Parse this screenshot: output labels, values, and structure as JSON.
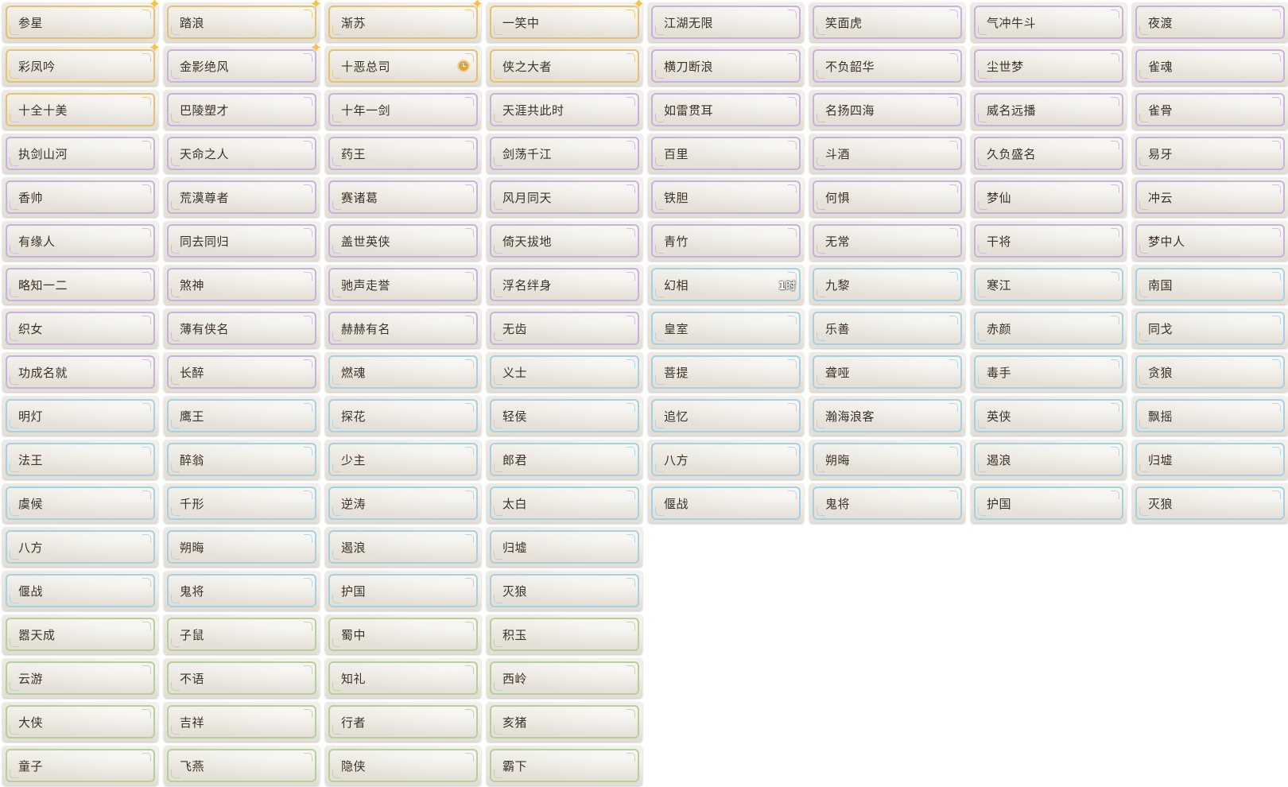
{
  "palette": {
    "gold": "#e2c27a",
    "purple": "#c7b2dd",
    "blue": "#a9cfe0",
    "green": "#b7cf9c"
  },
  "grid": {
    "columns": 8,
    "tiles": [
      {
        "label": "参星",
        "tier": "gold",
        "badge": "sparkle-icon"
      },
      {
        "label": "踏浪",
        "tier": "gold",
        "badge": "sparkle-icon"
      },
      {
        "label": "渐苏",
        "tier": "gold",
        "badge": "sparkle-icon"
      },
      {
        "label": "一笑中",
        "tier": "gold",
        "badge": "sparkle-icon"
      },
      {
        "label": "江湖无限",
        "tier": "purple"
      },
      {
        "label": "笑面虎",
        "tier": "purple"
      },
      {
        "label": "气冲牛斗",
        "tier": "purple"
      },
      {
        "label": "夜渡",
        "tier": "purple"
      },
      {
        "label": "彩凤吟",
        "tier": "gold",
        "badge": "sparkle-icon"
      },
      {
        "label": "金影绝风",
        "tier": "purple",
        "badge": "sparkle-icon"
      },
      {
        "label": "十恶总司",
        "tier": "gold",
        "badge": "clock-icon"
      },
      {
        "label": "侠之大者",
        "tier": "gold"
      },
      {
        "label": "横刀断浪",
        "tier": "purple"
      },
      {
        "label": "不负韶华",
        "tier": "purple"
      },
      {
        "label": "尘世梦",
        "tier": "purple"
      },
      {
        "label": "雀魂",
        "tier": "purple"
      },
      {
        "label": "十全十美",
        "tier": "gold"
      },
      {
        "label": "巴陵塑才",
        "tier": "purple"
      },
      {
        "label": "十年一剑",
        "tier": "purple"
      },
      {
        "label": "天涯共此时",
        "tier": "purple"
      },
      {
        "label": "如雷贯耳",
        "tier": "purple"
      },
      {
        "label": "名扬四海",
        "tier": "purple"
      },
      {
        "label": "威名远播",
        "tier": "purple"
      },
      {
        "label": "雀骨",
        "tier": "purple"
      },
      {
        "label": "执剑山河",
        "tier": "purple"
      },
      {
        "label": "天命之人",
        "tier": "purple"
      },
      {
        "label": "药王",
        "tier": "purple"
      },
      {
        "label": "剑荡千江",
        "tier": "purple"
      },
      {
        "label": "百里",
        "tier": "purple"
      },
      {
        "label": "斗酒",
        "tier": "purple"
      },
      {
        "label": "久负盛名",
        "tier": "purple"
      },
      {
        "label": "易牙",
        "tier": "purple"
      },
      {
        "label": "香帅",
        "tier": "purple"
      },
      {
        "label": "荒漠尊者",
        "tier": "purple"
      },
      {
        "label": "赛诸葛",
        "tier": "purple"
      },
      {
        "label": "风月同天",
        "tier": "purple"
      },
      {
        "label": "铁胆",
        "tier": "purple"
      },
      {
        "label": "何惧",
        "tier": "purple"
      },
      {
        "label": "梦仙",
        "tier": "purple"
      },
      {
        "label": "冲云",
        "tier": "purple"
      },
      {
        "label": "有缘人",
        "tier": "purple"
      },
      {
        "label": "同去同归",
        "tier": "purple"
      },
      {
        "label": "盖世英侠",
        "tier": "purple"
      },
      {
        "label": "倚天拔地",
        "tier": "purple"
      },
      {
        "label": "青竹",
        "tier": "purple"
      },
      {
        "label": "无常",
        "tier": "purple"
      },
      {
        "label": "干将",
        "tier": "purple"
      },
      {
        "label": "梦中人",
        "tier": "purple"
      },
      {
        "label": "略知一二",
        "tier": "purple"
      },
      {
        "label": "煞神",
        "tier": "purple"
      },
      {
        "label": "驰声走誉",
        "tier": "purple"
      },
      {
        "label": "浮名绊身",
        "tier": "purple"
      },
      {
        "label": "幻相",
        "tier": "blue",
        "timer": "1时"
      },
      {
        "label": "九黎",
        "tier": "blue"
      },
      {
        "label": "寒江",
        "tier": "blue"
      },
      {
        "label": "南国",
        "tier": "blue"
      },
      {
        "label": "织女",
        "tier": "purple"
      },
      {
        "label": "薄有侠名",
        "tier": "purple"
      },
      {
        "label": "赫赫有名",
        "tier": "purple"
      },
      {
        "label": "无齿",
        "tier": "purple"
      },
      {
        "label": "皇室",
        "tier": "blue"
      },
      {
        "label": "乐善",
        "tier": "blue"
      },
      {
        "label": "赤颜",
        "tier": "blue"
      },
      {
        "label": "同戈",
        "tier": "blue"
      },
      {
        "label": "功成名就",
        "tier": "purple"
      },
      {
        "label": "长醉",
        "tier": "purple"
      },
      {
        "label": "燃魂",
        "tier": "blue"
      },
      {
        "label": "义士",
        "tier": "blue"
      },
      {
        "label": "菩提",
        "tier": "blue"
      },
      {
        "label": "聋哑",
        "tier": "blue"
      },
      {
        "label": "毒手",
        "tier": "blue"
      },
      {
        "label": "贪狼",
        "tier": "blue"
      },
      {
        "label": "明灯",
        "tier": "blue"
      },
      {
        "label": "鹰王",
        "tier": "blue"
      },
      {
        "label": "探花",
        "tier": "blue"
      },
      {
        "label": "轻侯",
        "tier": "blue"
      },
      {
        "label": "追忆",
        "tier": "blue"
      },
      {
        "label": "瀚海浪客",
        "tier": "blue"
      },
      {
        "label": "英侠",
        "tier": "blue"
      },
      {
        "label": "飘摇",
        "tier": "blue"
      },
      {
        "label": "法王",
        "tier": "blue"
      },
      {
        "label": "醉翁",
        "tier": "blue"
      },
      {
        "label": "少主",
        "tier": "blue"
      },
      {
        "label": "郎君",
        "tier": "blue"
      },
      {
        "label": "八方",
        "tier": "blue"
      },
      {
        "label": "朔晦",
        "tier": "blue"
      },
      {
        "label": "遏浪",
        "tier": "blue"
      },
      {
        "label": "归墟",
        "tier": "blue"
      },
      {
        "label": "虞候",
        "tier": "blue"
      },
      {
        "label": "千形",
        "tier": "blue"
      },
      {
        "label": "逆涛",
        "tier": "blue"
      },
      {
        "label": "太白",
        "tier": "blue"
      },
      {
        "label": "偃战",
        "tier": "blue"
      },
      {
        "label": "鬼将",
        "tier": "blue"
      },
      {
        "label": "护国",
        "tier": "blue"
      },
      {
        "label": "灭狼",
        "tier": "blue"
      },
      {
        "label": "八方",
        "tier": "blue"
      },
      {
        "label": "朔晦",
        "tier": "blue"
      },
      {
        "label": "遏浪",
        "tier": "blue"
      },
      {
        "label": "归墟",
        "tier": "blue"
      },
      {
        "label": "偃战",
        "tier": "blue"
      },
      {
        "label": "鬼将",
        "tier": "blue"
      },
      {
        "label": "护国",
        "tier": "blue"
      },
      {
        "label": "灭狼",
        "tier": "blue"
      },
      {
        "label": "嚣天成",
        "tier": "green"
      },
      {
        "label": "子鼠",
        "tier": "green"
      },
      {
        "label": "蜀中",
        "tier": "green"
      },
      {
        "label": "积玉",
        "tier": "green"
      },
      {
        "label": "云游",
        "tier": "green"
      },
      {
        "label": "不语",
        "tier": "green"
      },
      {
        "label": "知礼",
        "tier": "green"
      },
      {
        "label": "西岭",
        "tier": "green"
      },
      {
        "label": "大侠",
        "tier": "green"
      },
      {
        "label": "吉祥",
        "tier": "green"
      },
      {
        "label": "行者",
        "tier": "green"
      },
      {
        "label": "亥猪",
        "tier": "green"
      },
      {
        "label": "童子",
        "tier": "green"
      },
      {
        "label": "飞燕",
        "tier": "green"
      },
      {
        "label": "隐侠",
        "tier": "green"
      },
      {
        "label": "霸下",
        "tier": "green"
      }
    ]
  }
}
